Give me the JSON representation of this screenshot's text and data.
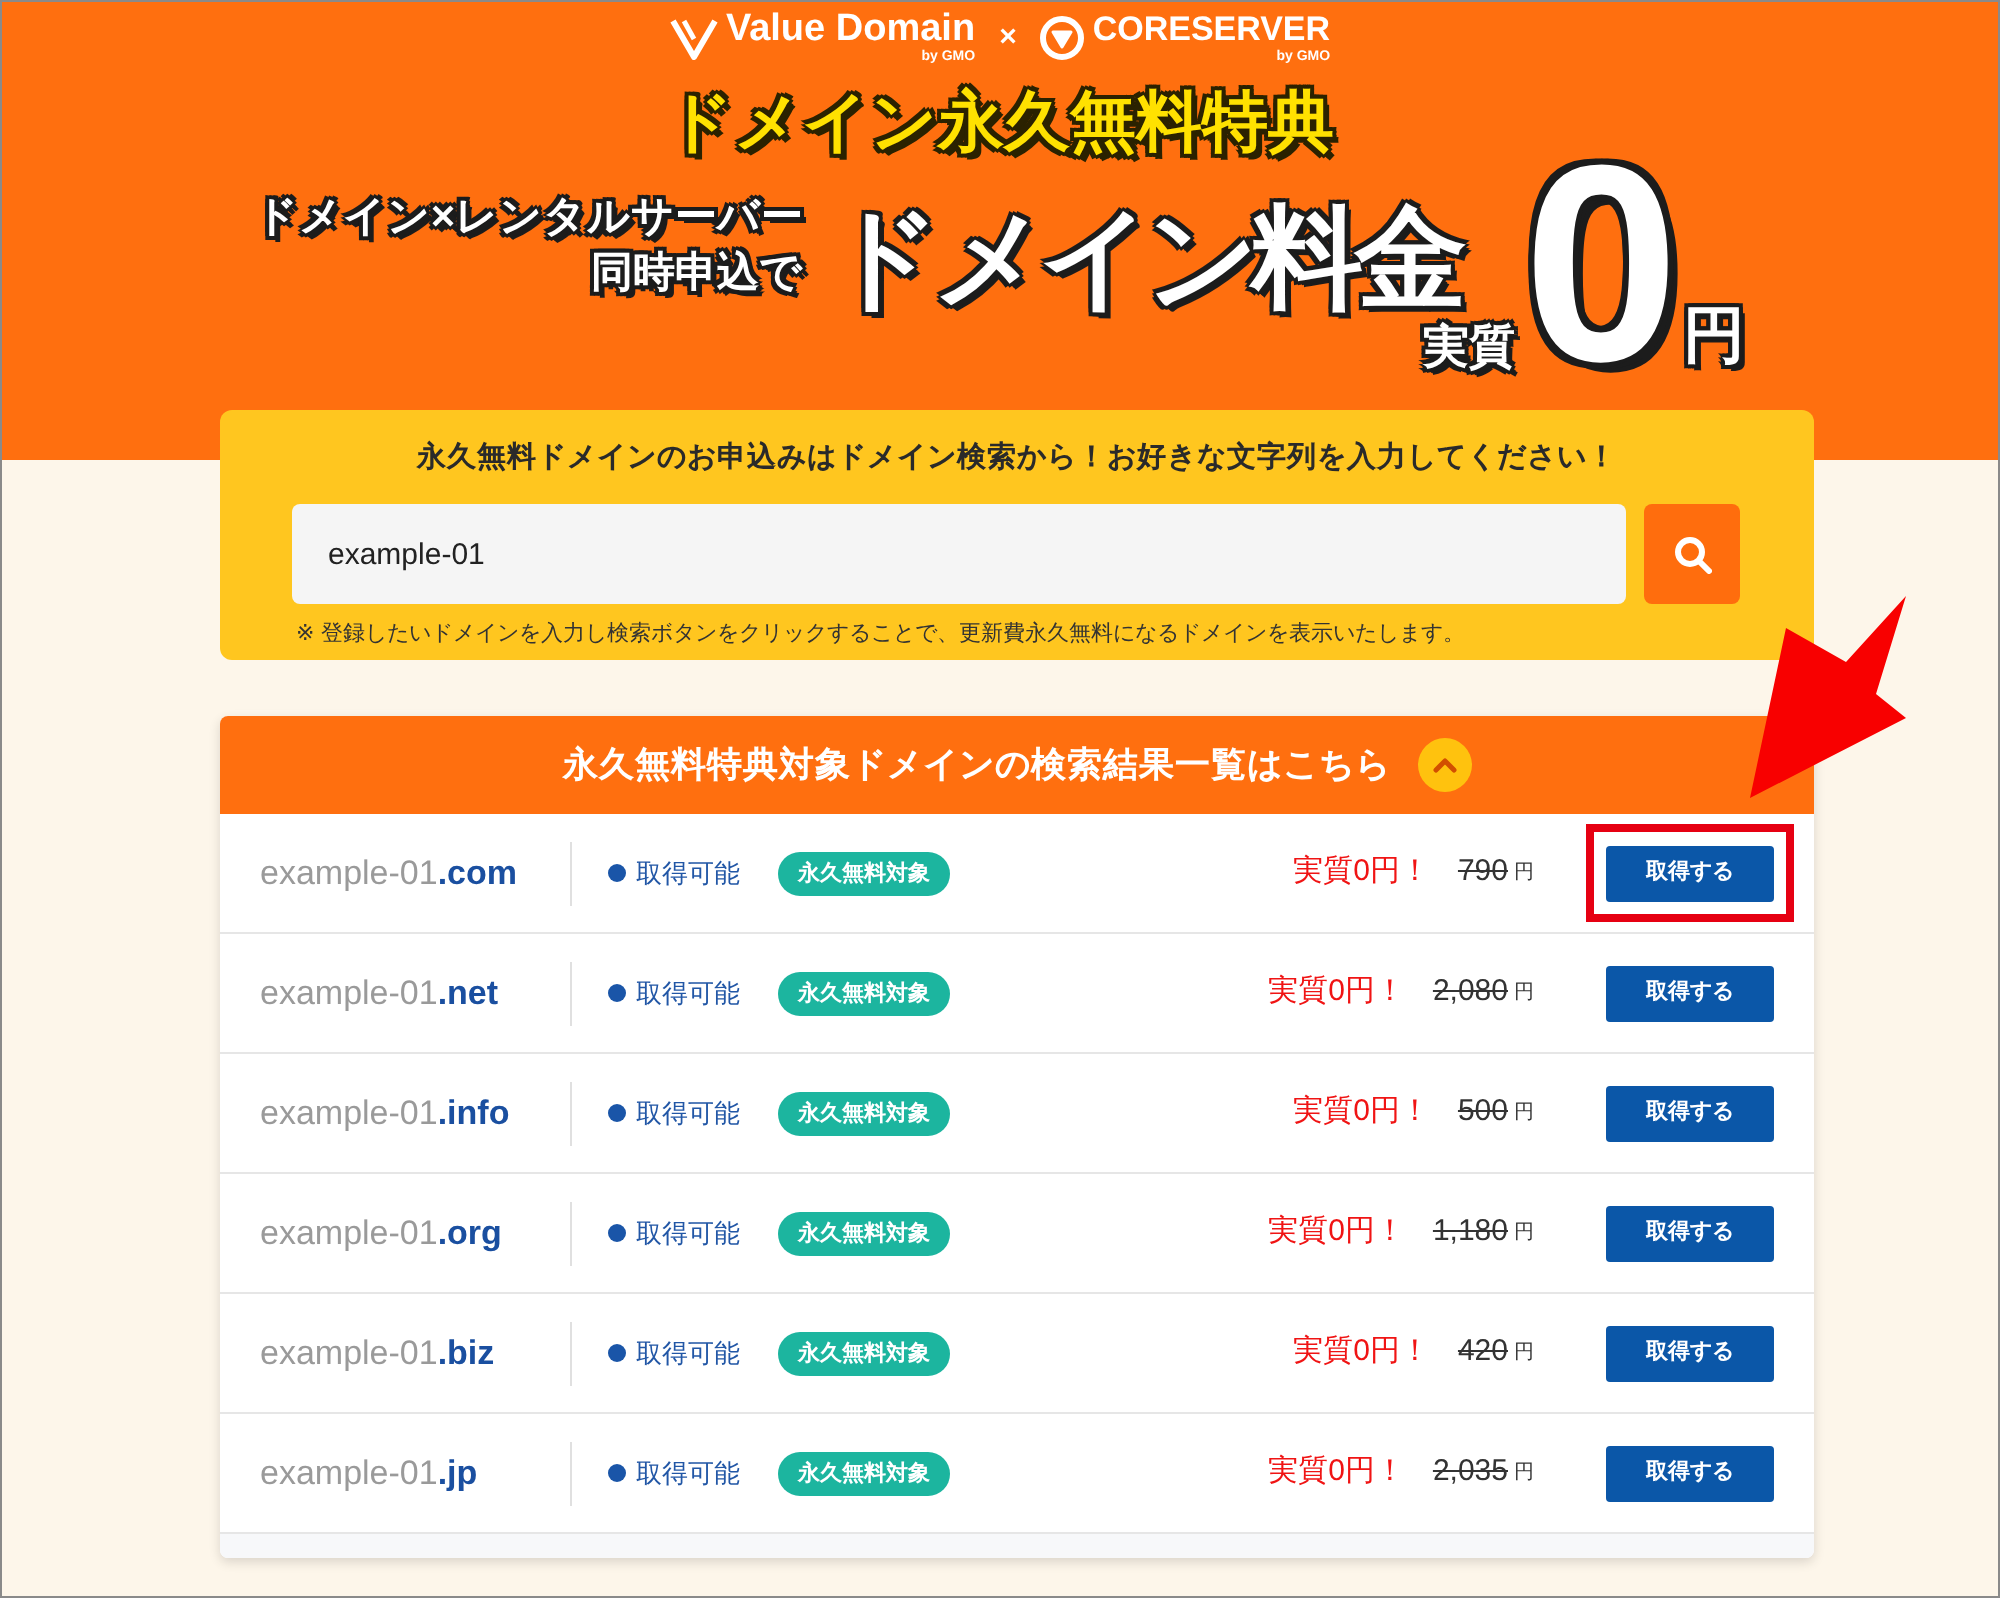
{
  "brand_bar": {
    "brands": [
      {
        "kind": "vmark",
        "name": "Value Domain",
        "byline": "by GMO"
      },
      {
        "kind": "ringmark",
        "name": "CORESERVER",
        "byline": "by GMO"
      }
    ],
    "separator": "×"
  },
  "hero": {
    "title": "ドメイン永久無料特典",
    "lead_lines": [
      "ドメイン×レンタルサーバー",
      "同時申込で"
    ],
    "headline": "ドメイン料金",
    "prefix": "実質",
    "amount": "0",
    "unit": "円"
  },
  "search": {
    "heading": "永久無料ドメインのお申込みはドメイン検索から！お好きな文字列を入力してください！",
    "value": "example-01",
    "note": "※ 登録したいドメインを入力し検索ボタンをクリックすることで、更新費永久無料になるドメインを表示いたします。"
  },
  "results": {
    "title": "永久無料特典対象ドメインの検索結果一覧はこちら",
    "expanded": true,
    "rows": [
      {
        "domain": "example-01**.com**",
        "status": "取得可能",
        "badge": "永久無料対象",
        "offer": "実質0円！",
        "price": "790",
        "currency": "円",
        "action": "取得する",
        "highlighted": true
      },
      {
        "domain": "example-01**.net**",
        "status": "取得可能",
        "badge": "永久無料対象",
        "offer": "実質0円！",
        "price": "2,080",
        "currency": "円",
        "action": "取得する",
        "highlighted": false
      },
      {
        "domain": "example-01**.info**",
        "status": "取得可能",
        "badge": "永久無料対象",
        "offer": "実質0円！",
        "price": "500",
        "currency": "円",
        "action": "取得する",
        "highlighted": false
      },
      {
        "domain": "example-01**.org**",
        "status": "取得可能",
        "badge": "永久無料対象",
        "offer": "実質0円！",
        "price": "1,180",
        "currency": "円",
        "action": "取得する",
        "highlighted": false
      },
      {
        "domain": "example-01**.biz**",
        "status": "取得可能",
        "badge": "永久無料対象",
        "offer": "実質0円！",
        "price": "420",
        "currency": "円",
        "action": "取得する",
        "highlighted": false
      },
      {
        "domain": "example-01**.jp**",
        "status": "取得可能",
        "badge": "永久無料対象",
        "offer": "実質0円！",
        "price": "2,035",
        "currency": "円",
        "action": "取得する",
        "highlighted": false
      }
    ]
  }
}
